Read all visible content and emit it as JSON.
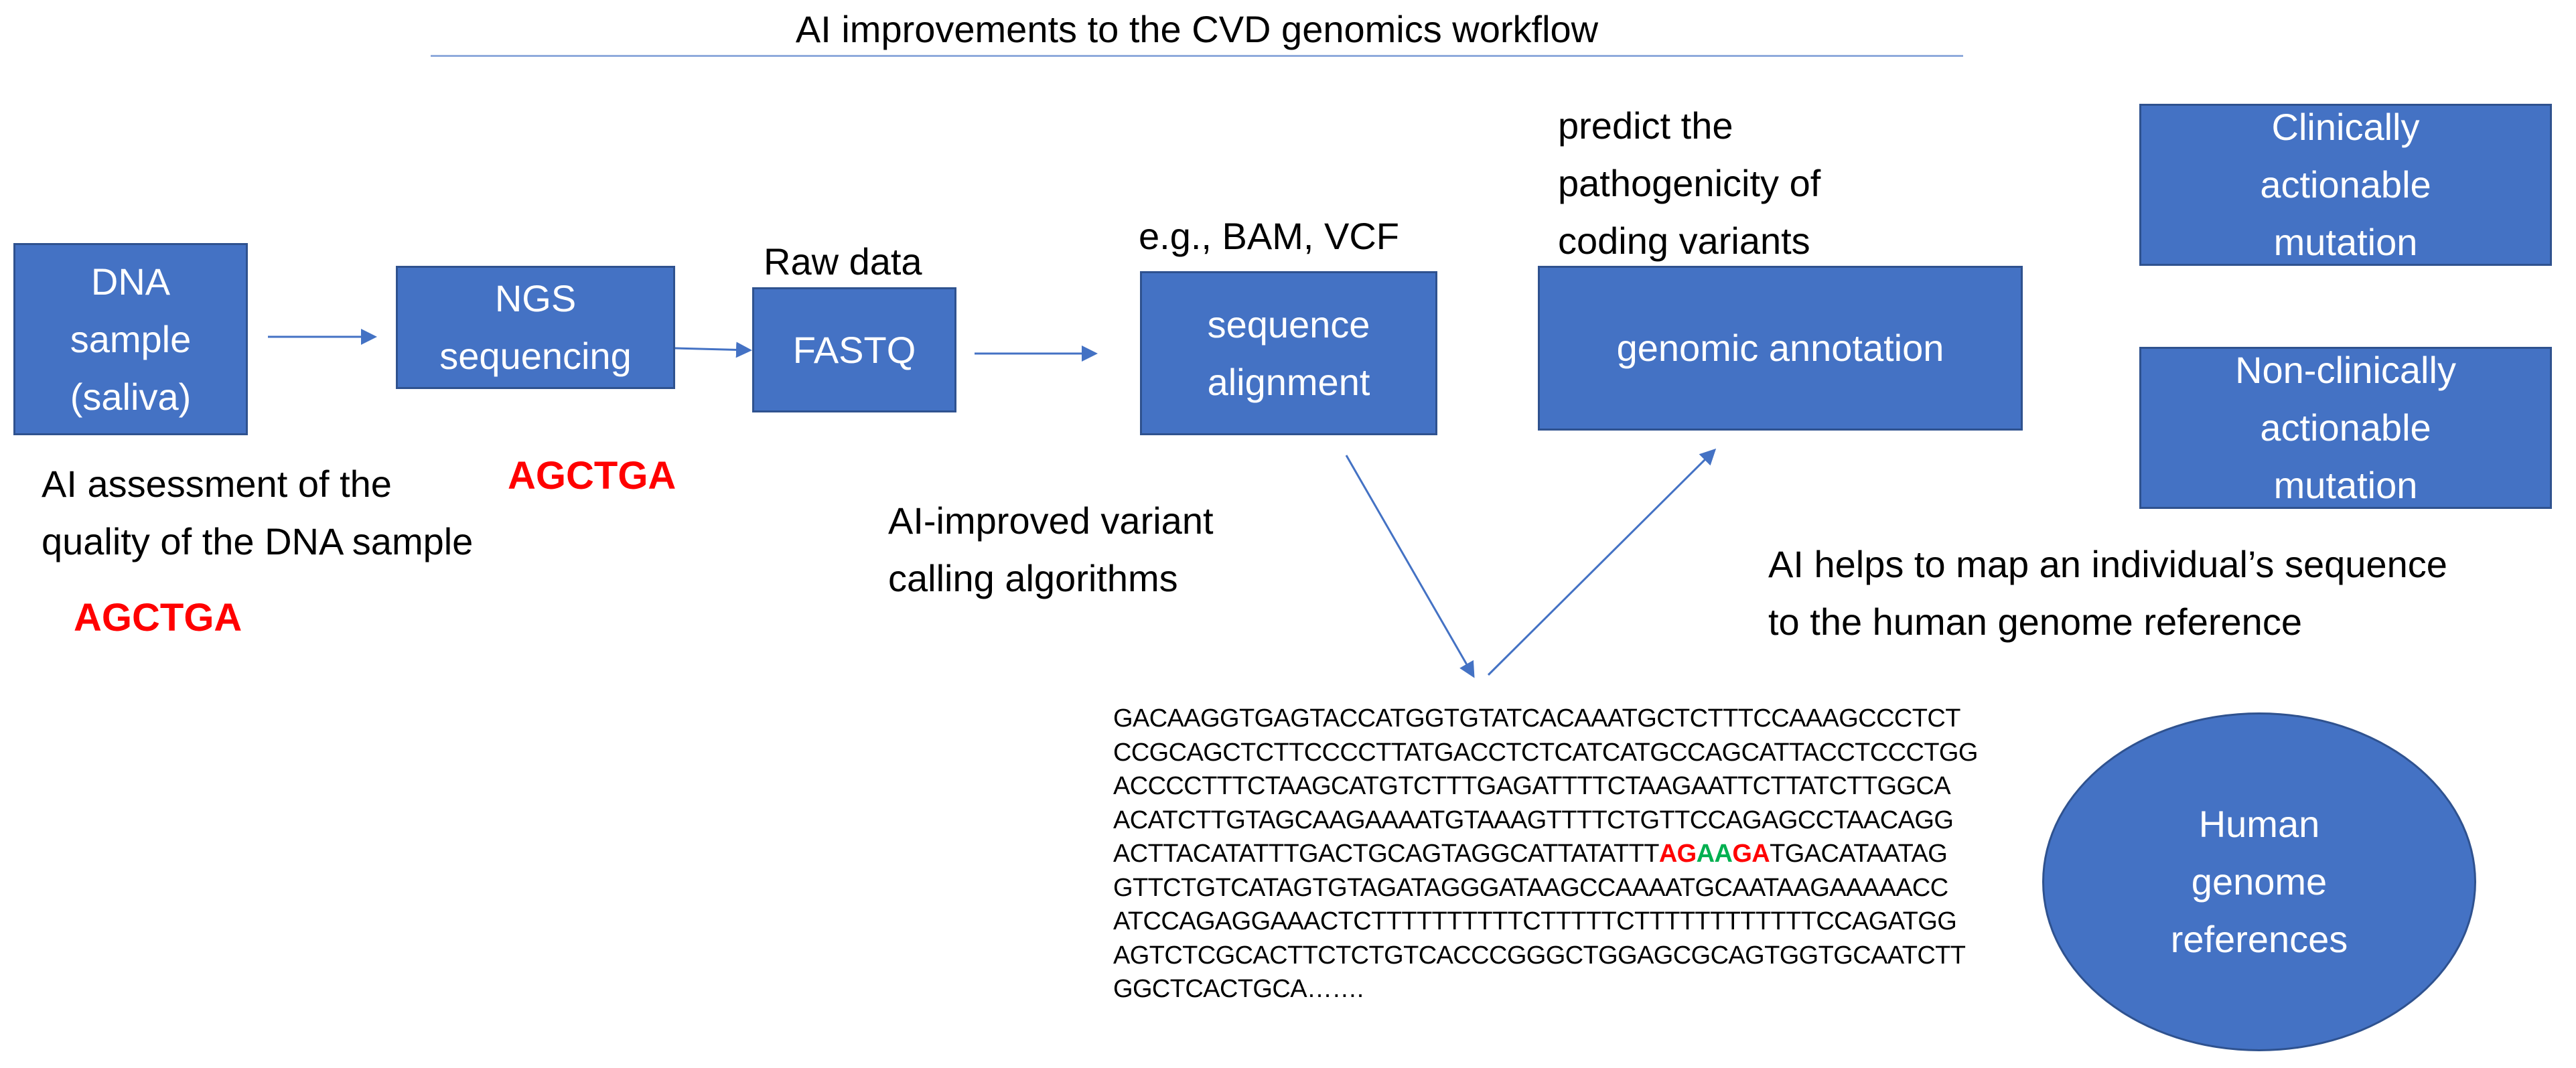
{
  "title": "AI improvements to the CVD genomics workflow",
  "colors": {
    "box_fill": "#4472C4",
    "box_border": "#2F528F",
    "arrow": "#4472C4",
    "title_rule": "#8FAADC",
    "highlight_red": "#FF0000",
    "highlight_green": "#00B050"
  },
  "boxes": {
    "dna_sample": "DNA\nsample\n(saliva)",
    "ngs_sequencing": "NGS\nsequencing",
    "fastq": "FASTQ",
    "sequence_alignment": "sequence\nalignment",
    "genomic_annotation": "genomic annotation",
    "clinically_actionable": "Clinically\nactionable\nmutation",
    "non_clinically_actionable": "Non-clinically\nactionable\nmutation",
    "human_genome_references": "Human\ngenome\nreferences"
  },
  "labels": {
    "raw_data": "Raw data",
    "file_formats": "e.g., BAM, VCF",
    "predict_pathogenicity": "predict the\npathogenicity of\ncoding variants",
    "ai_assessment": "AI assessment of the\nquality of the DNA sample",
    "ai_variant_calling": "AI-improved variant\ncalling algorithms",
    "ai_mapping": "AI helps to map an individual’s sequence\nto the human genome reference"
  },
  "red_sequences": {
    "under_ngs": "AGCTGA",
    "under_assessment": "AGCTGA"
  },
  "sequence": {
    "lines": [
      "GACAAGGTGAGTACCATGGTGTATCACAAATGCTCTTTCCAAAGCCCTCT",
      "CCGCAGCTCTTCCCCTTATGACCTCTCATCATGCCAGCATTACCTCCCTGG",
      "ACCCCTTTCTAAGCATGTCTTTGAGATTTTCTAAGAATTCTTATCTTGGCA",
      "ACATCTTGTAGCAAGAAAATGTAAAGTTTTCTGTTCCAGAGCCTAACAGG"
    ],
    "highlight_line": {
      "prefix": "ACTTACATATTTGACTGCAGTAGGCATTATATTT",
      "red1": "AG",
      "green": "AA",
      "red2": "GA",
      "suffix": "TGACATAATAG"
    },
    "lines_after": [
      "GTTCTGTCATAGTGTAGATAGGGATAAGCCAAAATGCAATAAGAAAAACC",
      "ATCCAGAGGAAACTCTTTTTTTTTTCTTTTTCTTTTTTTTTTTTCCAGATGG",
      "AGTCTCGCACTTCTCTGTCACCCGGGCTGGAGCGCAGTGGTGCAATCTT",
      "GGCTCACTGCA……."
    ]
  }
}
